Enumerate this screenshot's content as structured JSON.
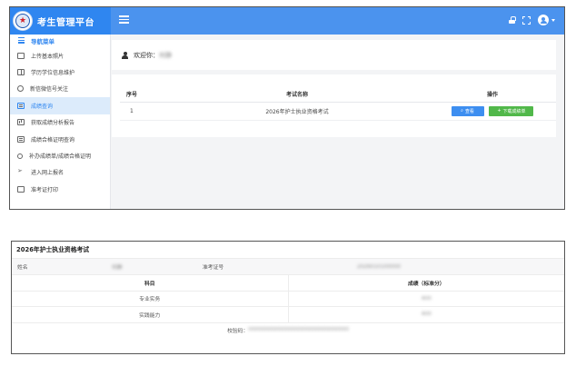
{
  "app": {
    "title": "考生管理平台",
    "logo_glyph": "★"
  },
  "sidebar": {
    "header": "导航菜单",
    "items": [
      {
        "label": "上传基本照片",
        "icon": "image-icon"
      },
      {
        "label": "学历学位信息维护",
        "icon": "book-icon"
      },
      {
        "label": "新信微信号关注",
        "icon": "people-icon"
      },
      {
        "label": "成绩查询",
        "icon": "file-icon",
        "active": true
      },
      {
        "label": "获取成绩分析报告",
        "icon": "file-icon"
      },
      {
        "label": "成绩合格证明查询",
        "icon": "file-icon"
      },
      {
        "label": "补办成绩单/成绩合格证明",
        "icon": "search-icon"
      },
      {
        "label": "进入网上报名",
        "icon": "arrow-icon"
      },
      {
        "label": "准考证打印",
        "icon": "image-icon"
      }
    ]
  },
  "welcome": {
    "label": "欢迎你：",
    "name": "何静"
  },
  "exam_table": {
    "headers": [
      "序号",
      "考试名称",
      "操作"
    ],
    "rows": [
      {
        "index": "1",
        "name": "2026年护士执业资格考试",
        "view_label": "查看",
        "download_label": "下载成绩单"
      }
    ]
  },
  "score_panel": {
    "title": "2026年护士执业资格考试",
    "name_label": "姓名",
    "name_value": "何静",
    "ticket_label": "准考证号",
    "ticket_value": "2026010100000",
    "headers": [
      "科目",
      "成绩（标准分）"
    ],
    "rows": [
      {
        "subject": "专业实务",
        "score": "400"
      },
      {
        "subject": "实践能力",
        "score": "400"
      }
    ],
    "verify_label": "校验码：",
    "verify_value": "000000000000000000000000000000"
  },
  "colors": {
    "brand": "#2f86f0",
    "topbar": "#4b93ee",
    "view_button": "#3d8ef0",
    "download_button": "#51b84a"
  }
}
